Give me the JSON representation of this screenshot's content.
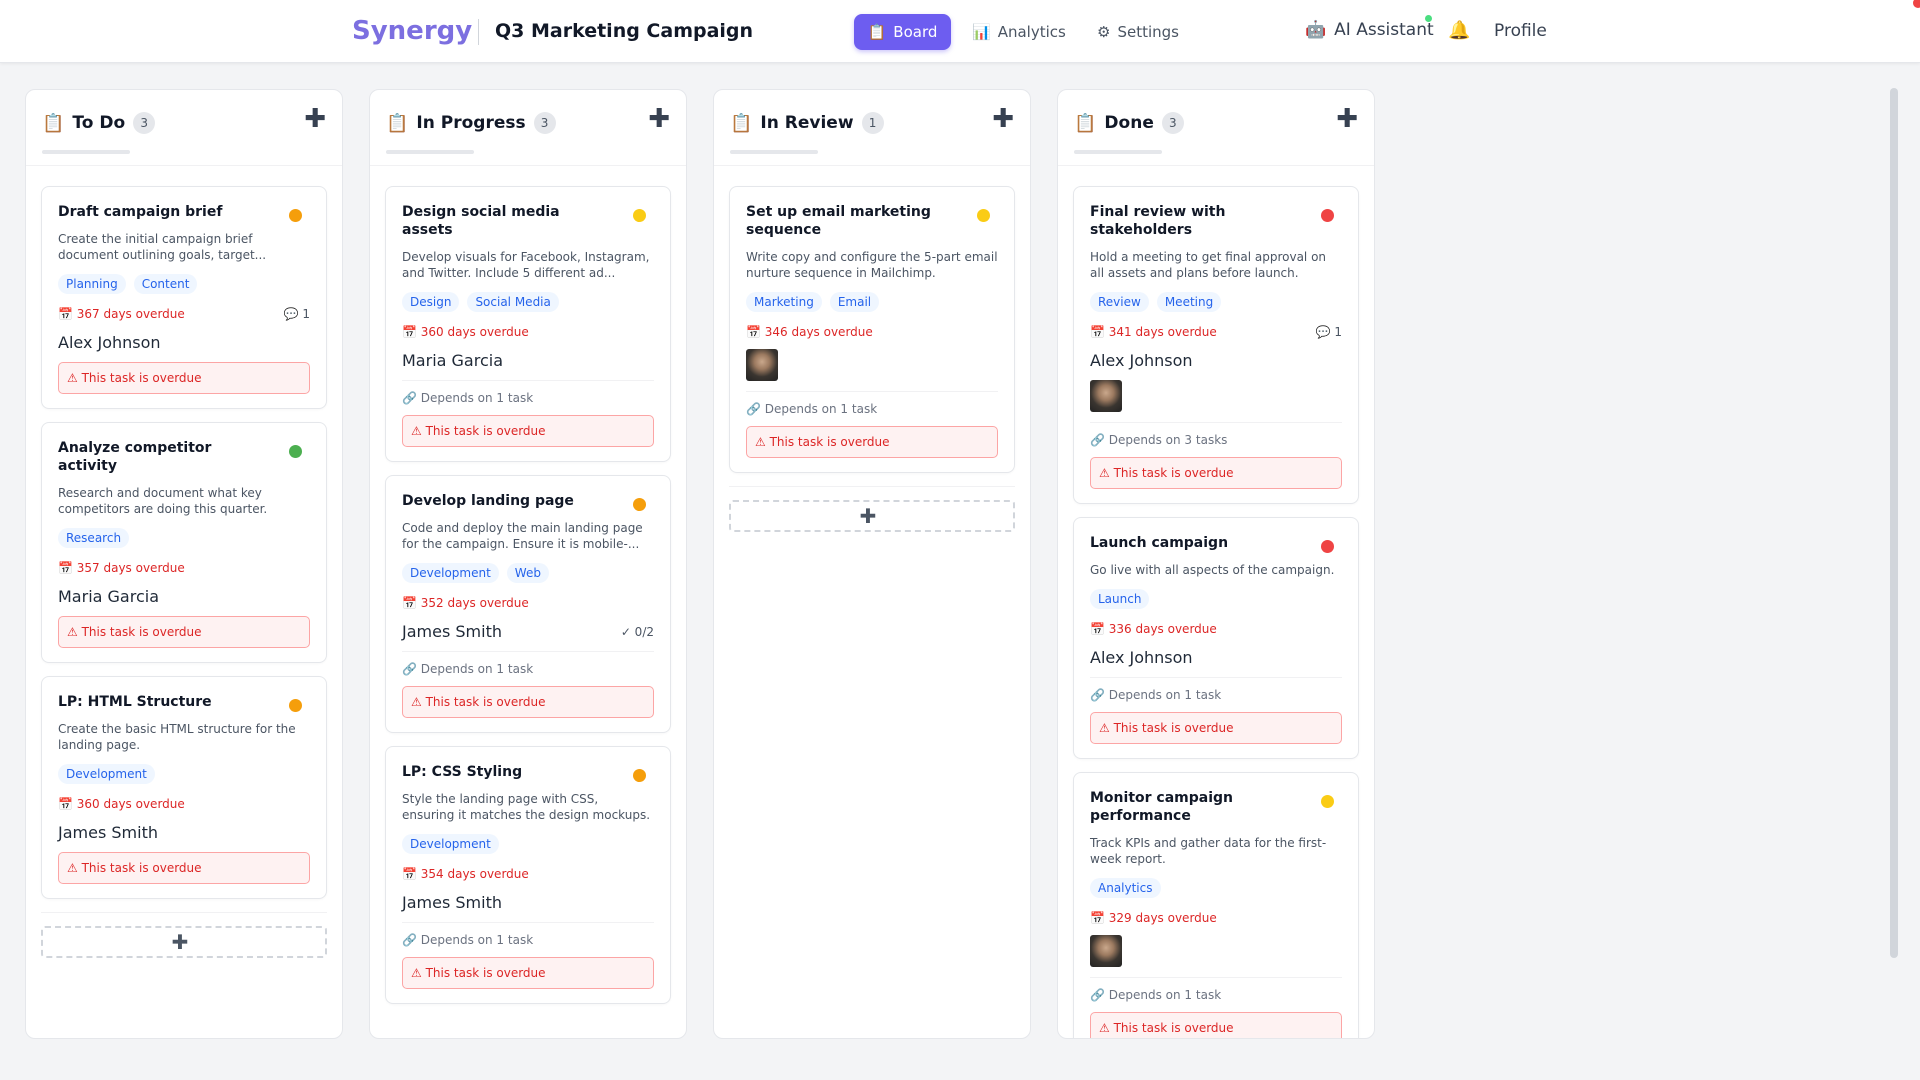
{
  "app": {
    "brand": "Synergy",
    "project": "Q3 Marketing Campaign",
    "nav": [
      {
        "label": "Board",
        "icon": "📋"
      },
      {
        "label": "Analytics",
        "icon": "📊"
      },
      {
        "label": "Settings",
        "icon": "⚙"
      }
    ],
    "ai_label": "AI Assistant",
    "ai_icon": "🤖",
    "bell_icon": "🔔",
    "profile": "Profile"
  },
  "colors": {
    "accent": "#6d5df0",
    "brand": "#7c6fe0",
    "overdue": "#dc2626",
    "priority_high": "#ef4444",
    "priority_medium": "#f59e0b",
    "priority_low": "#facc15",
    "priority_done": "#22c55e"
  },
  "add_card_label": "Add a card",
  "columns": [
    {
      "title": "To Do",
      "count": "3",
      "icon": "📋",
      "cards": [
        {
          "title": "Draft campaign brief",
          "desc": "Create the initial campaign brief document outlining goals, target...",
          "tags": [
            "Planning",
            "Content"
          ],
          "due": "📅 367 days overdue",
          "comments": "💬 1",
          "assignee": "Alex Johnson",
          "alert": "⚠ This task is overdue",
          "priority": "#f59e0b"
        },
        {
          "title": "Analyze competitor activity",
          "desc": "Research and document what key competitors are doing this quarter.",
          "tags": [
            "Research"
          ],
          "due": "📅 357 days overdue",
          "assignee": "Maria Garcia",
          "alert": "⚠ This task is overdue",
          "priority": "#4caf50"
        },
        {
          "title": "LP: HTML Structure",
          "desc": "Create the basic HTML structure for the landing page.",
          "tags": [
            "Development"
          ],
          "due": "📅 360 days overdue",
          "assignee": "James Smith",
          "alert": "⚠ This task is overdue",
          "priority": "#f59e0b"
        }
      ]
    },
    {
      "title": "In Progress",
      "count": "3",
      "icon": "📋",
      "cards": [
        {
          "title": "Design social media assets",
          "desc": "Develop visuals for Facebook, Instagram, and Twitter. Include 5 different ad...",
          "tags": [
            "Design",
            "Social Media"
          ],
          "due": "📅 360 days overdue",
          "assignee": "Maria Garcia",
          "dep": "🔗 Depends on 1 task",
          "alert": "⚠ This task is overdue",
          "priority": "#facc15"
        },
        {
          "title": "Develop landing page",
          "desc": "Code and deploy the main landing page for the campaign. Ensure it is mobile-...",
          "tags": [
            "Development",
            "Web"
          ],
          "due": "📅 352 days overdue",
          "assignee": "James Smith",
          "checklist": "✓ 0/2",
          "dep": "🔗 Depends on 1 task",
          "alert": "⚠ This task is overdue",
          "priority": "#f59e0b"
        },
        {
          "title": "LP: CSS Styling",
          "desc": "Style the landing page with CSS, ensuring it matches the design mockups.",
          "tags": [
            "Development"
          ],
          "due": "📅 354 days overdue",
          "assignee": "James Smith",
          "dep": "🔗 Depends on 1 task",
          "alert": "⚠ This task is overdue",
          "priority": "#f59e0b"
        }
      ]
    },
    {
      "title": "In Review",
      "count": "1",
      "icon": "📋",
      "cards": [
        {
          "title": "Set up email marketing sequence",
          "desc": "Write copy and configure the 5-part email nurture sequence in Mailchimp.",
          "tags": [
            "Marketing",
            "Email"
          ],
          "due": "📅 346 days overdue",
          "photo": true,
          "dep": "🔗 Depends on 1 task",
          "alert": "⚠ This task is overdue",
          "priority": "#facc15"
        }
      ]
    },
    {
      "title": "Done",
      "count": "3",
      "icon": "📋",
      "cards": [
        {
          "title": "Final review with stakeholders",
          "desc": "Hold a meeting to get final approval on all assets and plans before launch.",
          "tags": [
            "Review",
            "Meeting"
          ],
          "due": "📅 341 days overdue",
          "comments": "💬 1",
          "assignee": "Alex Johnson",
          "photo": true,
          "dep": "🔗 Depends on 3 tasks",
          "alert": "⚠ This task is overdue",
          "priority": "#ef4444"
        },
        {
          "title": "Launch campaign",
          "desc": "Go live with all aspects of the campaign.",
          "tags": [
            "Launch"
          ],
          "due": "📅 336 days overdue",
          "assignee": "Alex Johnson",
          "dep": "🔗 Depends on 1 task",
          "alert": "⚠ This task is overdue",
          "priority": "#ef4444"
        },
        {
          "title": "Monitor campaign performance",
          "desc": "Track KPIs and gather data for the first-week report.",
          "tags": [
            "Analytics"
          ],
          "due": "📅 329 days overdue",
          "photo": true,
          "dep": "🔗 Depends on 1 task",
          "alert": "⚠ This task is overdue",
          "priority": "#facc15"
        }
      ]
    }
  ]
}
